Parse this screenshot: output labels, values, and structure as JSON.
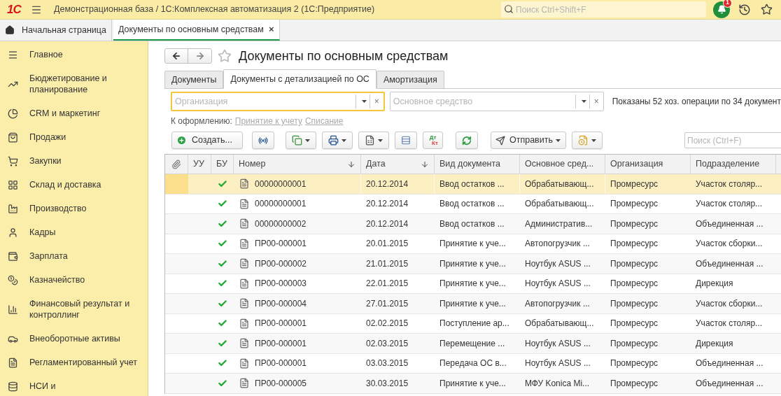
{
  "header": {
    "logo": "1С",
    "title": "Демонстрационная база / 1С:Комплексная автоматизация 2  (1С:Предприятие)",
    "search_placeholder": "Поиск Ctrl+Shift+F",
    "notification_count": "1"
  },
  "open_tabs": [
    {
      "label": "Начальная страница",
      "selected": false,
      "kind": "home"
    },
    {
      "label": "Документы по основным средствам",
      "selected": true,
      "kind": "doc",
      "close": "×"
    }
  ],
  "sidebar": {
    "items": [
      {
        "label": "Главное"
      },
      {
        "label": "Бюджетирование и планирование"
      },
      {
        "label": "CRM и маркетинг"
      },
      {
        "label": "Продажи"
      },
      {
        "label": "Закупки"
      },
      {
        "label": "Склад и доставка"
      },
      {
        "label": "Производство"
      },
      {
        "label": "Кадры"
      },
      {
        "label": "Зарплата"
      },
      {
        "label": "Казначейство"
      },
      {
        "label": "Финансовый результат и контроллинг"
      },
      {
        "label": "Внеоборотные активы"
      },
      {
        "label": "Регламентированный учет"
      },
      {
        "label": "НСИ и"
      }
    ]
  },
  "form": {
    "title": "Документы по основным средствам",
    "favorite": false,
    "tabs": [
      {
        "label": "Документы",
        "selected": false
      },
      {
        "label": "Документы с детализацией по ОС",
        "selected": true
      },
      {
        "label": "Амортизация",
        "selected": false
      }
    ],
    "filters": [
      {
        "placeholder": "Организация",
        "focused": true,
        "clear": "×"
      },
      {
        "placeholder": "Основное средство",
        "focused": false,
        "clear": "×"
      }
    ],
    "summary": "Показаны 52 хоз. операции по 34 документ",
    "todo_label": "К оформлению:",
    "todo_links": [
      "Принятие к учету",
      "Списание"
    ],
    "toolbar": {
      "create": "Создать...",
      "send": "Отправить",
      "dt": "Дт",
      "kt": "Кт",
      "search_placeholder": "Поиск (Ctrl+F)"
    },
    "table": {
      "columns": [
        "",
        "УУ",
        "БУ",
        "Номер",
        "Дата",
        "Вид документа",
        "Основное сред...",
        "Организация",
        "Подразделение"
      ],
      "rows": [
        {
          "selected": true,
          "posted": true,
          "number": "00000000001",
          "date": "20.12.2014",
          "type": "Ввод остатков ...",
          "asset": "Обрабатывающ...",
          "org": "Промресурс",
          "dept": "Участок столяр..."
        },
        {
          "selected": false,
          "posted": true,
          "number": "00000000001",
          "date": "20.12.2014",
          "type": "Ввод остатков ...",
          "asset": "Обрабатывающ...",
          "org": "Промресурс",
          "dept": "Участок столяр..."
        },
        {
          "selected": false,
          "posted": true,
          "number": "00000000002",
          "date": "20.12.2014",
          "type": "Ввод остатков ...",
          "asset": "Административ...",
          "org": "Промресурс",
          "dept": "Объединенная ..."
        },
        {
          "selected": false,
          "posted": true,
          "number": "ПР00-000001",
          "date": "20.01.2015",
          "type": "Принятие к уче...",
          "asset": "Автопогрузчик ...",
          "org": "Промресурс",
          "dept": "Участок сборки..."
        },
        {
          "selected": false,
          "posted": true,
          "number": "ПР00-000002",
          "date": "21.01.2015",
          "type": "Принятие к уче...",
          "asset": "Ноутбук ASUS ...",
          "org": "Промресурс",
          "dept": "Объединенная ..."
        },
        {
          "selected": false,
          "posted": true,
          "number": "ПР00-000003",
          "date": "22.01.2015",
          "type": "Принятие к уче...",
          "asset": "Ноутбук ASUS ...",
          "org": "Промресурс",
          "dept": "Дирекция"
        },
        {
          "selected": false,
          "posted": true,
          "number": "ПР00-000004",
          "date": "27.01.2015",
          "type": "Принятие к уче...",
          "asset": "Автопогрузчик ...",
          "org": "Промресурс",
          "dept": "Участок сборки..."
        },
        {
          "selected": false,
          "posted": true,
          "number": "ПР00-000001",
          "date": "02.02.2015",
          "type": "Поступление ар...",
          "asset": "Обрабатывающ...",
          "org": "Промресурс",
          "dept": "Участок столяр..."
        },
        {
          "selected": false,
          "posted": true,
          "number": "ПР00-000001",
          "date": "02.03.2015",
          "type": "Перемещение ...",
          "asset": "Ноутбук ASUS ...",
          "org": "Промресурс",
          "dept": "Дирекция"
        },
        {
          "selected": false,
          "posted": true,
          "number": "ПР00-000001",
          "date": "03.03.2015",
          "type": "Передача ОС в...",
          "asset": "Ноутбук ASUS ...",
          "org": "Промресурс",
          "dept": "Объединенная ..."
        },
        {
          "selected": false,
          "posted": true,
          "number": "ПР00-000005",
          "date": "30.03.2015",
          "type": "Принятие к уче...",
          "asset": "МФУ Konica Mi...",
          "org": "Промресурс",
          "dept": "Объединенная ..."
        }
      ]
    }
  }
}
